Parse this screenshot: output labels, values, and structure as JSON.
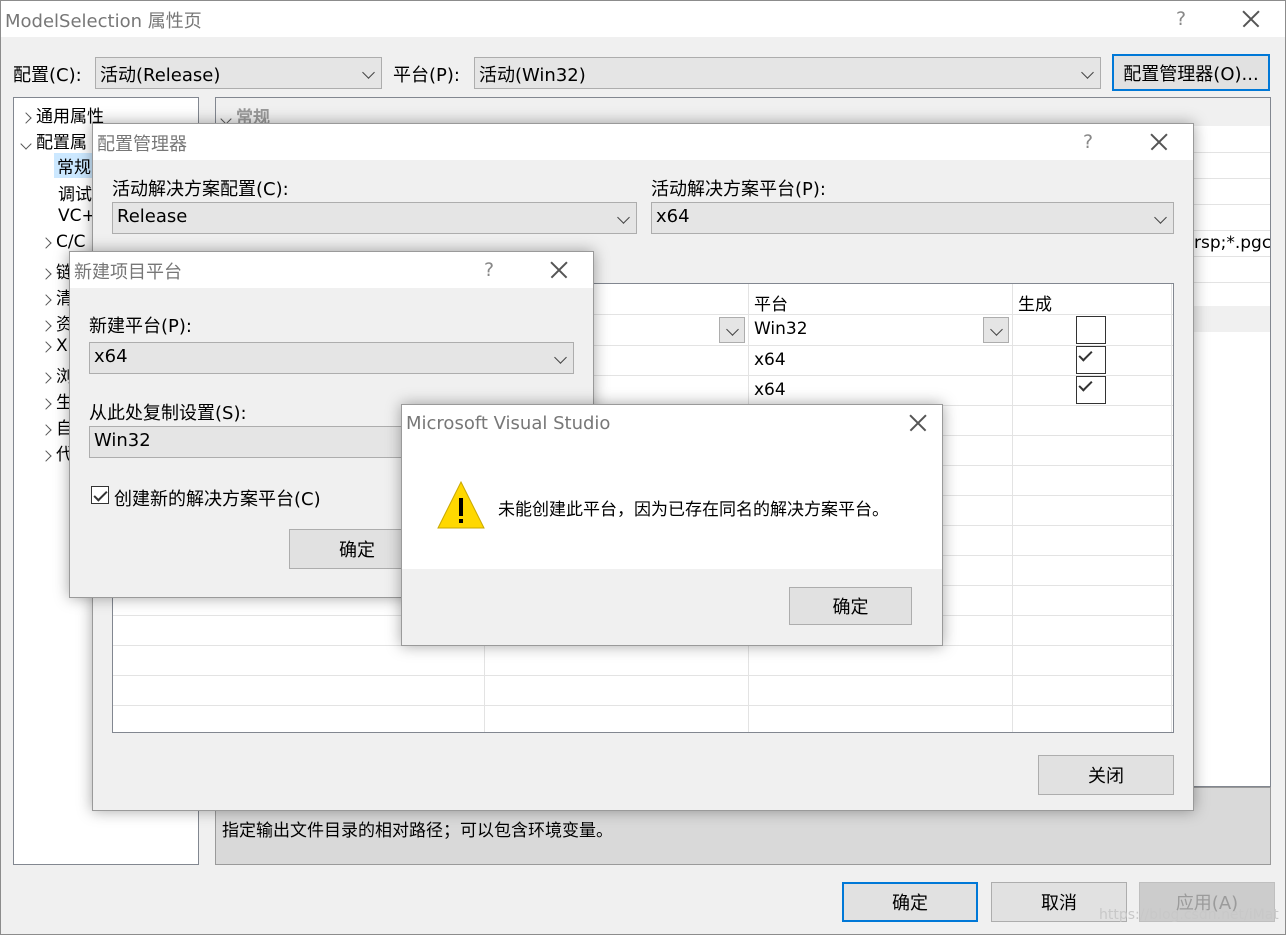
{
  "main": {
    "title": "ModelSelection 属性页",
    "help": "?",
    "config_label": "配置(C):",
    "config_value": "活动(Release)",
    "platform_label": "平台(P):",
    "platform_value": "活动(Win32)",
    "config_manager_button": "配置管理器(O)...",
    "tree": [
      {
        "label": "通用属性",
        "expanded": false
      },
      {
        "label": "配置属",
        "expanded": true
      },
      {
        "label": "常规",
        "selected": true
      },
      {
        "label": "调试"
      },
      {
        "label": "VC+"
      },
      {
        "label": "C/C",
        "expanded": false
      },
      {
        "label": "链",
        "expanded": false
      },
      {
        "label": "清",
        "expanded": false
      },
      {
        "label": "资",
        "expanded": false
      },
      {
        "label": "X",
        "expanded": false
      },
      {
        "label": "浏",
        "expanded": false
      },
      {
        "label": "生",
        "expanded": false
      },
      {
        "label": "自",
        "expanded": false
      },
      {
        "label": "代",
        "expanded": false
      }
    ],
    "section_header": "常规",
    "prop_fragment": "rsp;*.pgc",
    "description": "指定输出文件目录的相对路径；可以包含环境变量。",
    "ok_button": "确定",
    "cancel_button": "取消",
    "apply_button": "应用(A)",
    "watermark": "https://blog.csdn.net/iMat"
  },
  "config_manager": {
    "title": "配置管理器",
    "help": "?",
    "active_config_label": "活动解决方案配置(C):",
    "active_config_value": "Release",
    "active_platform_label": "活动解决方案平台(P):",
    "active_platform_value": "x64",
    "columns": {
      "platform": "平台",
      "build": "生成"
    },
    "rows": [
      {
        "platform": "Win32",
        "build": false
      },
      {
        "platform": "x64",
        "build": true
      },
      {
        "platform": "x64",
        "build": true
      }
    ],
    "close_button": "关闭"
  },
  "new_platform": {
    "title": "新建项目平台",
    "help": "?",
    "new_platform_label": "新建平台(P):",
    "new_platform_value": "x64",
    "copy_from_label": "从此处复制设置(S):",
    "copy_from_value": "Win32",
    "create_solution_platform_label": "创建新的解决方案平台(C)",
    "create_solution_platform_checked": true,
    "ok_button": "确定"
  },
  "message_box": {
    "title": "Microsoft Visual Studio",
    "icon": "warning-icon",
    "message": "未能创建此平台，因为已存在同名的解决方案平台。",
    "ok_button": "确定"
  }
}
